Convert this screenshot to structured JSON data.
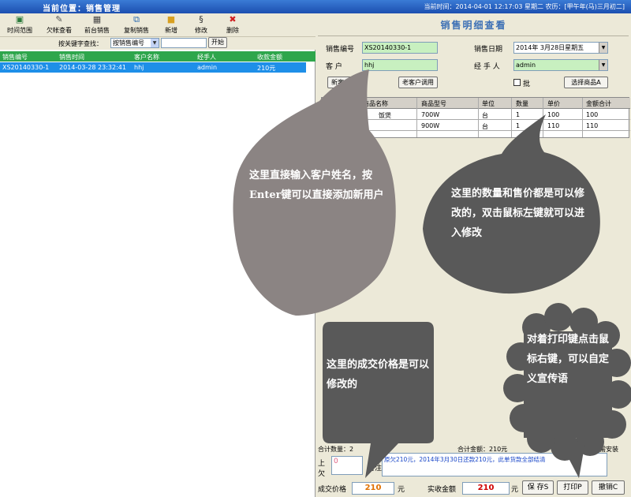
{
  "titlebar": {
    "location": "当前位置：销售管理",
    "time_text": "当前时间：2014-04-01  12:17:03  星期二",
    "lunar_text": "农历：[甲午年(马)三月初二]"
  },
  "toolbar": {
    "buttons": [
      {
        "label": "时间范围",
        "icon": "clock-icon"
      },
      {
        "label": "欠帐查看",
        "icon": "debt-icon"
      },
      {
        "label": "前台销售",
        "icon": "cashier-icon"
      },
      {
        "label": "复制销售",
        "icon": "copy-icon"
      },
      {
        "label": "新增",
        "icon": "folder-icon"
      },
      {
        "label": "修改",
        "icon": "edit-icon"
      },
      {
        "label": "删除",
        "icon": "delete-icon"
      }
    ]
  },
  "search": {
    "label": "按关键字查找：",
    "field_selected": "按销售编号",
    "input_value": "",
    "button": "开始"
  },
  "left_table": {
    "headers": [
      "销售编号",
      "销售时间",
      "客户名称",
      "经手人",
      "收款金额"
    ],
    "rows": [
      [
        "XS20140330-1",
        "2014-03-28 23:32:41",
        "hhj",
        "admin",
        "210元"
      ]
    ]
  },
  "detail": {
    "title": "销售明细查看",
    "sale_no_label": "销售编号",
    "sale_no_value": "XS20140330-1",
    "sale_date_label": "销售日期",
    "sale_date_value": "2014年 3月28日星期五",
    "customer_label": "客  户",
    "customer_value": "hhj",
    "handler_label": "经 手 人",
    "handler_value": "admin",
    "new_customer_button": "新客户添加",
    "old_customer_button": "老客户调用",
    "checkbox_label": "批",
    "select_product_button": "选择商品A"
  },
  "product_table": {
    "headers": [
      "商品名称",
      "商品型号",
      "单位",
      "数量",
      "单价",
      "金额合计"
    ],
    "rows": [
      [
        "饭煲",
        "700W",
        "台",
        "1",
        "100",
        "100"
      ],
      [
        "",
        "900W",
        "台",
        "1",
        "110",
        "110"
      ]
    ]
  },
  "bottom": {
    "total_qty": "合计数量：2",
    "total_amount": "合计金额：210元",
    "installer_text": "需安装",
    "prev_owed_label": "上欠",
    "prev_owed_value": "0",
    "memo_label": "备注",
    "memo_value": "原欠210元，2014年3月30日还款210元，此单货款全部结清",
    "deal_price_label": "成交价格",
    "deal_price_value": "210",
    "yuan": "元",
    "paid_label": "实收金额",
    "paid_value": "210",
    "save_button": "保 存S",
    "print_button": "打印P",
    "cancel_button": "撤销C"
  },
  "callouts": [
    "这里直接输入客户姓名，按Enter键可以直接添加新用户",
    "这里的数量和售价都是可以修改的，双击鼠标左键就可以进入修改",
    "这里的成交价格是可以修改的",
    "对着打印键点击鼠标右键，可以自定义宣传语"
  ],
  "colors": {
    "titlebar": "#1c4fb0",
    "list_header": "#2ea64c",
    "selected_row": "#1e8fe8",
    "detail_title": "#3b6fb5",
    "bubble_gray": "#8b8483",
    "bubble_dark": "#595959"
  }
}
